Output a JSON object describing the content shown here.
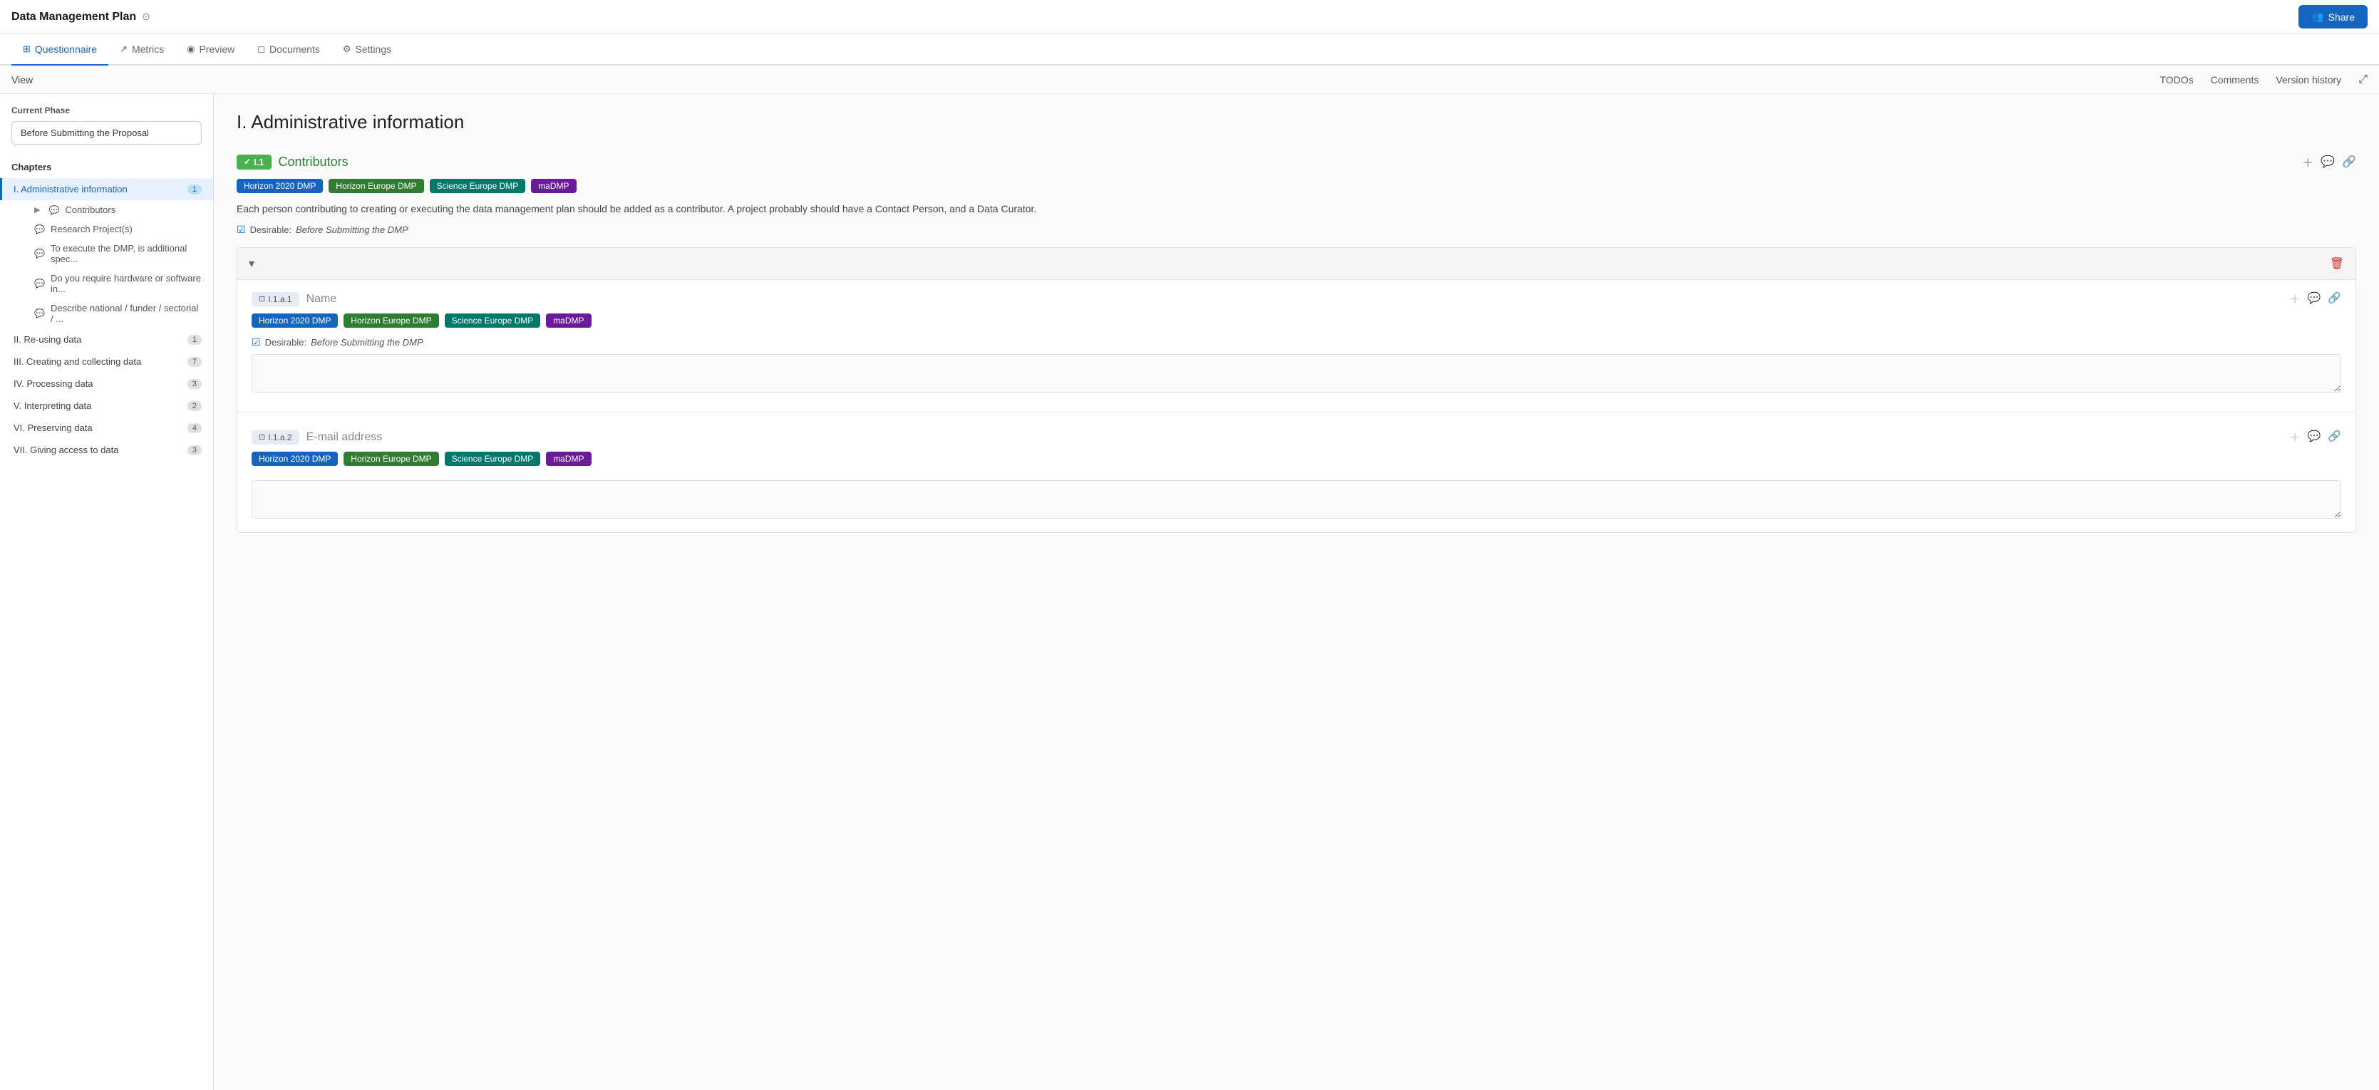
{
  "topBar": {
    "title": "Data Management Plan",
    "shareLabel": "Share"
  },
  "tabs": [
    {
      "id": "questionnaire",
      "label": "Questionnaire",
      "icon": "⊞",
      "active": true
    },
    {
      "id": "metrics",
      "label": "Metrics",
      "icon": "↗",
      "active": false
    },
    {
      "id": "preview",
      "label": "Preview",
      "icon": "◉",
      "active": false
    },
    {
      "id": "documents",
      "label": "Documents",
      "icon": "◻",
      "active": false
    },
    {
      "id": "settings",
      "label": "Settings",
      "icon": "⚙",
      "active": false
    }
  ],
  "secondaryBar": {
    "viewLabel": "View",
    "todos": "TODOs",
    "comments": "Comments",
    "versionHistory": "Version history"
  },
  "sidebar": {
    "currentPhaseLabel": "Current Phase",
    "currentPhaseValue": "Before Submitting the Proposal",
    "chaptersLabel": "Chapters",
    "chapters": [
      {
        "id": "I",
        "label": "I.  Administrative information",
        "badge": "1",
        "active": true
      },
      {
        "id": "II",
        "label": "II.  Re-using data",
        "badge": "1",
        "active": false
      },
      {
        "id": "III",
        "label": "III.  Creating and collecting data",
        "badge": "7",
        "active": false
      },
      {
        "id": "IV",
        "label": "IV.  Processing data",
        "badge": "3",
        "active": false
      },
      {
        "id": "V",
        "label": "V.  Interpreting data",
        "badge": "2",
        "active": false
      },
      {
        "id": "VI",
        "label": "VI.  Preserving data",
        "badge": "4",
        "active": false
      },
      {
        "id": "VII",
        "label": "VII.  Giving access to data",
        "badge": "3",
        "active": false
      }
    ],
    "subItems": [
      {
        "label": "Contributors",
        "hasExpand": true
      },
      {
        "label": "Research Project(s)"
      },
      {
        "label": "To execute the DMP, is additional spec..."
      },
      {
        "label": "Do you require hardware or software in..."
      },
      {
        "label": "Describe national / funder / sectorial / ..."
      }
    ]
  },
  "content": {
    "pageTitle": "I. Administrative information",
    "question1": {
      "id": "I.1",
      "checkmark": "✓",
      "title": "Contributors",
      "tags": [
        "Horizon 2020 DMP",
        "Horizon Europe DMP",
        "Science Europe DMP",
        "maDMP"
      ],
      "description": "Each person contributing to creating or executing the data management plan should be added as a contributor. A project probably should have a Contact Person, and a Data Curator.",
      "desirable": "Desirable:",
      "desirableValue": "Before Submitting the DMP",
      "subQuestion1": {
        "id": "I.1.a.1",
        "title": "Name",
        "tags": [
          "Horizon 2020 DMP",
          "Horizon Europe DMP",
          "Science Europe DMP",
          "maDMP"
        ],
        "desirable": "Desirable:",
        "desirableValue": "Before Submitting the DMP",
        "placeholder": ""
      },
      "subQuestion2": {
        "id": "I.1.a.2",
        "title": "E-mail address",
        "tags": [
          "Horizon 2020 DMP",
          "Horizon Europe DMP",
          "Science Europe DMP",
          "maDMP"
        ],
        "placeholder": ""
      }
    }
  }
}
